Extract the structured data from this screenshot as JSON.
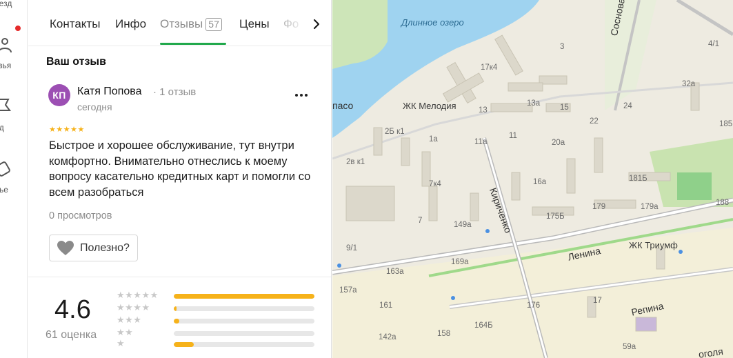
{
  "rail": {
    "items": [
      {
        "label": "резд",
        "icon": "route-icon"
      },
      {
        "label": "узья",
        "icon": "friends-icon"
      },
      {
        "label": "ид",
        "icon": "guide-icon"
      },
      {
        "label": "лье",
        "icon": "wallet-icon"
      }
    ],
    "notification_color": "#e52b2b"
  },
  "tabs": {
    "items": [
      {
        "label": "Контакты"
      },
      {
        "label": "Инфо"
      },
      {
        "label": "Отзывы",
        "count": "57",
        "active": true
      },
      {
        "label": "Цены"
      },
      {
        "label": "Фо"
      }
    ],
    "accent_color": "#20a84b"
  },
  "review": {
    "section_title": "Ваш отзыв",
    "avatar_initials": "КП",
    "avatar_color": "#9c4fb3",
    "author": "Катя Попова",
    "author_reviews": "1 отзыв",
    "date": "сегодня",
    "stars": 5,
    "stars_text": "★★★★★",
    "text": "Быстрое и хорошее обслуживание, тут внутри комфортно. Внимательно отнеслись к моему вопросу касательно кредитных карт и помогли со всем разобраться",
    "views": "0 просмотров",
    "useful_label": "Полезно?"
  },
  "rating": {
    "value": "4.6",
    "count_label": "61 оценка",
    "star_color": "#f6b21a",
    "distribution": [
      {
        "stars": 5,
        "stars_text": "★★★★★",
        "fraction": 1.0
      },
      {
        "stars": 4,
        "stars_text": "★★★★",
        "fraction": 0.02
      },
      {
        "stars": 3,
        "stars_text": "★★★",
        "fraction": 0.04
      },
      {
        "stars": 2,
        "stars_text": "★★",
        "fraction": 0.0
      },
      {
        "stars": 1,
        "stars_text": "★",
        "fraction": 0.14
      }
    ]
  },
  "map": {
    "water_label": "Длинное озеро",
    "streets": [
      "Сосновая",
      "Кириченко",
      "Ленина",
      "Репина",
      "пасо",
      "оголя"
    ],
    "poi": [
      "ЖК Мелодия",
      "ЖК Триумф"
    ],
    "houses": [
      "3",
      "4/1",
      "17к4",
      "32а",
      "13а",
      "15",
      "24",
      "13",
      "22",
      "185",
      "2Б к1",
      "1а",
      "11а",
      "11",
      "20а",
      "2в к1",
      "7к4",
      "16а",
      "181Б",
      "175Б",
      "179",
      "179а",
      "188",
      "7",
      "149а",
      "9/1",
      "169а",
      "163а",
      "157а",
      "161",
      "176",
      "17",
      "164Б",
      "142а",
      "158",
      "59а"
    ]
  }
}
